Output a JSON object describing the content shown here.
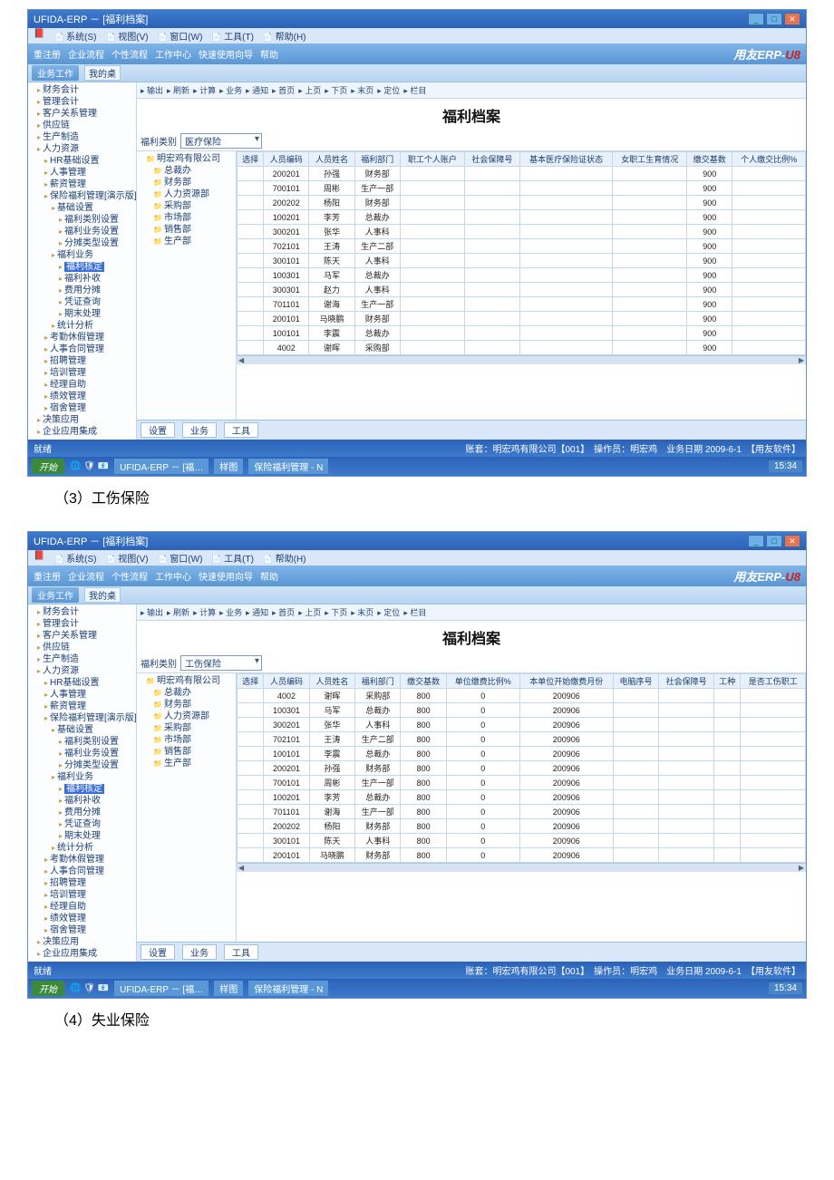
{
  "captions": {
    "c3": "（3）工伤保险",
    "c4": "（4）失业保险"
  },
  "shared": {
    "app_title": "UFIDA-ERP － [福利档案]",
    "menus": [
      "系统(S)",
      "视图(V)",
      "窗口(W)",
      "工具(T)",
      "帮助(H)"
    ],
    "linkbar": [
      "重注册",
      "企业流程",
      "个性流程",
      "工作中心",
      "快速使用向导",
      "帮助"
    ],
    "erp_brand": "用友ERP-",
    "erp_suffix": "U8",
    "work_label": "业务工作",
    "work_btn": "我的桌",
    "page_title": "福利档案",
    "toolbar_items": [
      "输出",
      "刷新",
      "计算",
      "业务",
      "通知",
      "首页",
      "上页",
      "下页",
      "末页",
      "定位",
      "栏目"
    ],
    "filter_label": "福利类别",
    "nav_tree": [
      "财务会计",
      "管理会计",
      "客户关系管理",
      "供应链",
      "生产制造",
      "人力资源",
      "  HR基础设置",
      "  人事管理",
      "  薪资管理",
      "  保险福利管理[演示版]",
      "    基础设置",
      "      福利类别设置",
      "      福利业务设置",
      "      分摊类型设置",
      "    福利业务",
      "      福利核定",
      "      福利补收",
      "      费用分摊",
      "      凭证查询",
      "      期末处理",
      "    统计分析",
      "  考勤休假管理",
      "  人事合同管理",
      "  招聘管理",
      "  培训管理",
      "  经理自助",
      "  绩效管理",
      "  宿舍管理",
      "决策应用",
      "企业应用集成"
    ],
    "subtree_company": "明宏鸡有限公司",
    "subtree_depts": [
      "总裁办",
      "财务部",
      "人力资源部",
      "采购部",
      "市场部",
      "销售部",
      "生产部"
    ],
    "bottom_tabs": [
      "设置",
      "业务",
      "工具"
    ],
    "status_left": "就绪",
    "status_right": "账套：明宏鸡有限公司【001】　操作员：明宏鸡　业务日期 2009-6-1　【用友软件】",
    "taskbar": {
      "start": "开始",
      "app": "UFIDA-ERP － [福…",
      "folder": "样图",
      "task": "保险福利管理 - N",
      "time": "15:34"
    }
  },
  "win1": {
    "filter_value": "医疗保险",
    "selected_node": "福利核定",
    "cols": [
      "选择",
      "人员编码",
      "人员姓名",
      "福利部门",
      "职工个人账户",
      "社会保障号",
      "基本医疗保险证状态",
      "女职工生育情况",
      "缴交基数",
      "个人缴交比例%"
    ],
    "rows": [
      [
        "",
        "200201",
        "孙强",
        "财务部",
        "",
        "",
        "",
        "",
        "900",
        ""
      ],
      [
        "",
        "700101",
        "周彬",
        "生产一部",
        "",
        "",
        "",
        "",
        "900",
        ""
      ],
      [
        "",
        "200202",
        "杨阳",
        "财务部",
        "",
        "",
        "",
        "",
        "900",
        ""
      ],
      [
        "",
        "100201",
        "李芳",
        "总裁办",
        "",
        "",
        "",
        "",
        "900",
        ""
      ],
      [
        "",
        "300201",
        "张华",
        "人事科",
        "",
        "",
        "",
        "",
        "900",
        ""
      ],
      [
        "",
        "702101",
        "王涛",
        "生产二部",
        "",
        "",
        "",
        "",
        "900",
        ""
      ],
      [
        "",
        "300101",
        "陈天",
        "人事科",
        "",
        "",
        "",
        "",
        "900",
        ""
      ],
      [
        "",
        "100301",
        "马军",
        "总裁办",
        "",
        "",
        "",
        "",
        "900",
        ""
      ],
      [
        "",
        "300301",
        "赵力",
        "人事科",
        "",
        "",
        "",
        "",
        "900",
        ""
      ],
      [
        "",
        "701101",
        "谢海",
        "生产一部",
        "",
        "",
        "",
        "",
        "900",
        ""
      ],
      [
        "",
        "200101",
        "马晓鹏",
        "财务部",
        "",
        "",
        "",
        "",
        "900",
        ""
      ],
      [
        "",
        "100101",
        "李震",
        "总裁办",
        "",
        "",
        "",
        "",
        "900",
        ""
      ],
      [
        "",
        "4002",
        "谢晖",
        "采购部",
        "",
        "",
        "",
        "",
        "900",
        ""
      ]
    ]
  },
  "win2": {
    "filter_value": "工伤保险",
    "selected_node": "福利核定",
    "cols": [
      "选择",
      "人员编码",
      "人员姓名",
      "福利部门",
      "缴交基数",
      "单位缴费比例%",
      "本单位开始缴费月份",
      "电脑序号",
      "社会保障号",
      "工种",
      "是否工伤职工"
    ],
    "rows": [
      [
        "",
        "4002",
        "谢晖",
        "采购部",
        "800",
        "0",
        "200906",
        "",
        "",
        "",
        ""
      ],
      [
        "",
        "100301",
        "马军",
        "总裁办",
        "800",
        "0",
        "200906",
        "",
        "",
        "",
        ""
      ],
      [
        "",
        "300201",
        "张华",
        "人事科",
        "800",
        "0",
        "200906",
        "",
        "",
        "",
        ""
      ],
      [
        "",
        "702101",
        "王涛",
        "生产二部",
        "800",
        "0",
        "200906",
        "",
        "",
        "",
        ""
      ],
      [
        "",
        "100101",
        "李震",
        "总裁办",
        "800",
        "0",
        "200906",
        "",
        "",
        "",
        ""
      ],
      [
        "",
        "200201",
        "孙强",
        "财务部",
        "800",
        "0",
        "200906",
        "",
        "",
        "",
        ""
      ],
      [
        "",
        "700101",
        "周彬",
        "生产一部",
        "800",
        "0",
        "200906",
        "",
        "",
        "",
        ""
      ],
      [
        "",
        "100201",
        "李芳",
        "总裁办",
        "800",
        "0",
        "200906",
        "",
        "",
        "",
        ""
      ],
      [
        "",
        "701101",
        "谢海",
        "生产一部",
        "800",
        "0",
        "200906",
        "",
        "",
        "",
        ""
      ],
      [
        "",
        "200202",
        "杨阳",
        "财务部",
        "800",
        "0",
        "200906",
        "",
        "",
        "",
        ""
      ],
      [
        "",
        "300101",
        "陈天",
        "人事科",
        "800",
        "0",
        "200906",
        "",
        "",
        "",
        ""
      ],
      [
        "",
        "200101",
        "马晓鹏",
        "财务部",
        "800",
        "0",
        "200906",
        "",
        "",
        "",
        ""
      ]
    ]
  }
}
